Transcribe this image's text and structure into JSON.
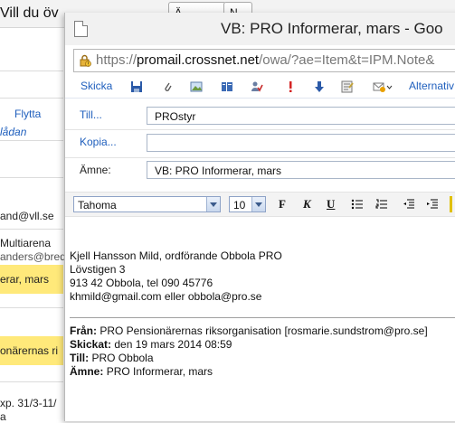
{
  "background": {
    "title": "Vill du öv",
    "title_suffix": "",
    "top_button_1": "Ä",
    "top_button_2": "N",
    "flytta_label": "Flytta",
    "ladan": "lådan",
    "email1": "and@vll.se",
    "arena": "Multiarena",
    "email2": "anders@bred",
    "yellow1": "erar, mars",
    "yellow2": "onärernas ri",
    "footer_text": "xp. 31/3-11/",
    "footer_text2": "a"
  },
  "popup": {
    "title": "VB: PRO Informerar, mars - Goo",
    "url_prefix": "https://",
    "url_domain": "promail.crossnet.net",
    "url_rest": "/owa/?ae=Item&t=IPM.Note&",
    "toolbar": {
      "send": "Skicka",
      "alternatives": "Alternativ"
    },
    "fields": {
      "to_label": "Till...",
      "to_value": "PROstyr",
      "cc_label": "Kopia...",
      "cc_value": "",
      "subject_label": "Ämne:",
      "subject_value": "VB: PRO Informerar, mars"
    },
    "format": {
      "font": "Tahoma",
      "size": "10",
      "bold": "F",
      "italic": "K",
      "underline": "U"
    },
    "signature": {
      "line1": "Kjell Hansson Mild, ordförande Obbola PRO",
      "line2": "Lövstigen 3",
      "line3": "913 42 Obbola, tel 090 45776",
      "line4": "khmild@gmail.com eller obbola@pro.se"
    },
    "forward": {
      "from_label": "Från:",
      "from_value": "PRO Pensionärernas riksorganisation [rosmarie.sundstrom@pro.se]",
      "sent_label": "Skickat:",
      "sent_value": "den 19 mars 2014 08:59",
      "to_label": "Till:",
      "to_value": "PRO Obbola",
      "subject_label": "Ämne:",
      "subject_value": "PRO Informerar, mars"
    }
  },
  "colors": {
    "accent": "#1f5fbd",
    "highlight": "#ffe97a"
  }
}
